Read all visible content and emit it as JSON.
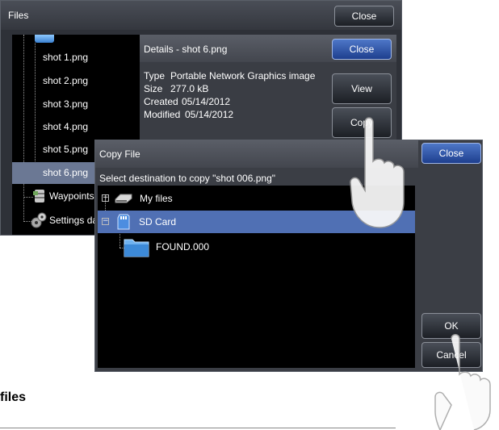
{
  "files_window": {
    "title": "Files",
    "close_label": "Close",
    "files": [
      {
        "name": "shot 1.png",
        "selected": false
      },
      {
        "name": "shot 2.png",
        "selected": false
      },
      {
        "name": "shot 3.png",
        "selected": false
      },
      {
        "name": "shot 4.png",
        "selected": false
      },
      {
        "name": "shot 5.png",
        "selected": false
      },
      {
        "name": "shot 6.png",
        "selected": true
      }
    ],
    "folders": [
      {
        "name": "Waypoints",
        "icon": "waypoints-db-icon"
      },
      {
        "name": "Settings da",
        "icon": "settings-gears-icon"
      }
    ]
  },
  "details": {
    "title": "Details - shot 6.png",
    "close_label": "Close",
    "rows": [
      {
        "key": "Type",
        "value": "Portable Network Graphics image"
      },
      {
        "key": "Size",
        "value": "277.0 kB"
      },
      {
        "key": "Created",
        "value": "05/14/2012"
      },
      {
        "key": "Modified",
        "value": "05/14/2012"
      }
    ],
    "view_label": "View",
    "copy_label": "Copy"
  },
  "copy_dialog": {
    "title": "Copy File",
    "close_label": "Close",
    "prompt": "Select destination to copy \"shot 006.png\"",
    "tree": [
      {
        "label": "My files",
        "expander": "+",
        "icon": "drive-icon",
        "selected": false
      },
      {
        "label": "SD Card",
        "expander": "−",
        "icon": "sd-card-icon",
        "selected": true
      },
      {
        "label": "FOUND.000",
        "icon": "folder-icon",
        "selected": false
      }
    ],
    "ok_label": "OK",
    "cancel_label": "Cancel"
  },
  "page": {
    "section_heading": "files"
  },
  "colors": {
    "selection_blue": "#5070b4",
    "selected_file_grey": "#6b7894",
    "window_bg": "#2e3138",
    "accent_button": "#2d56aa"
  }
}
